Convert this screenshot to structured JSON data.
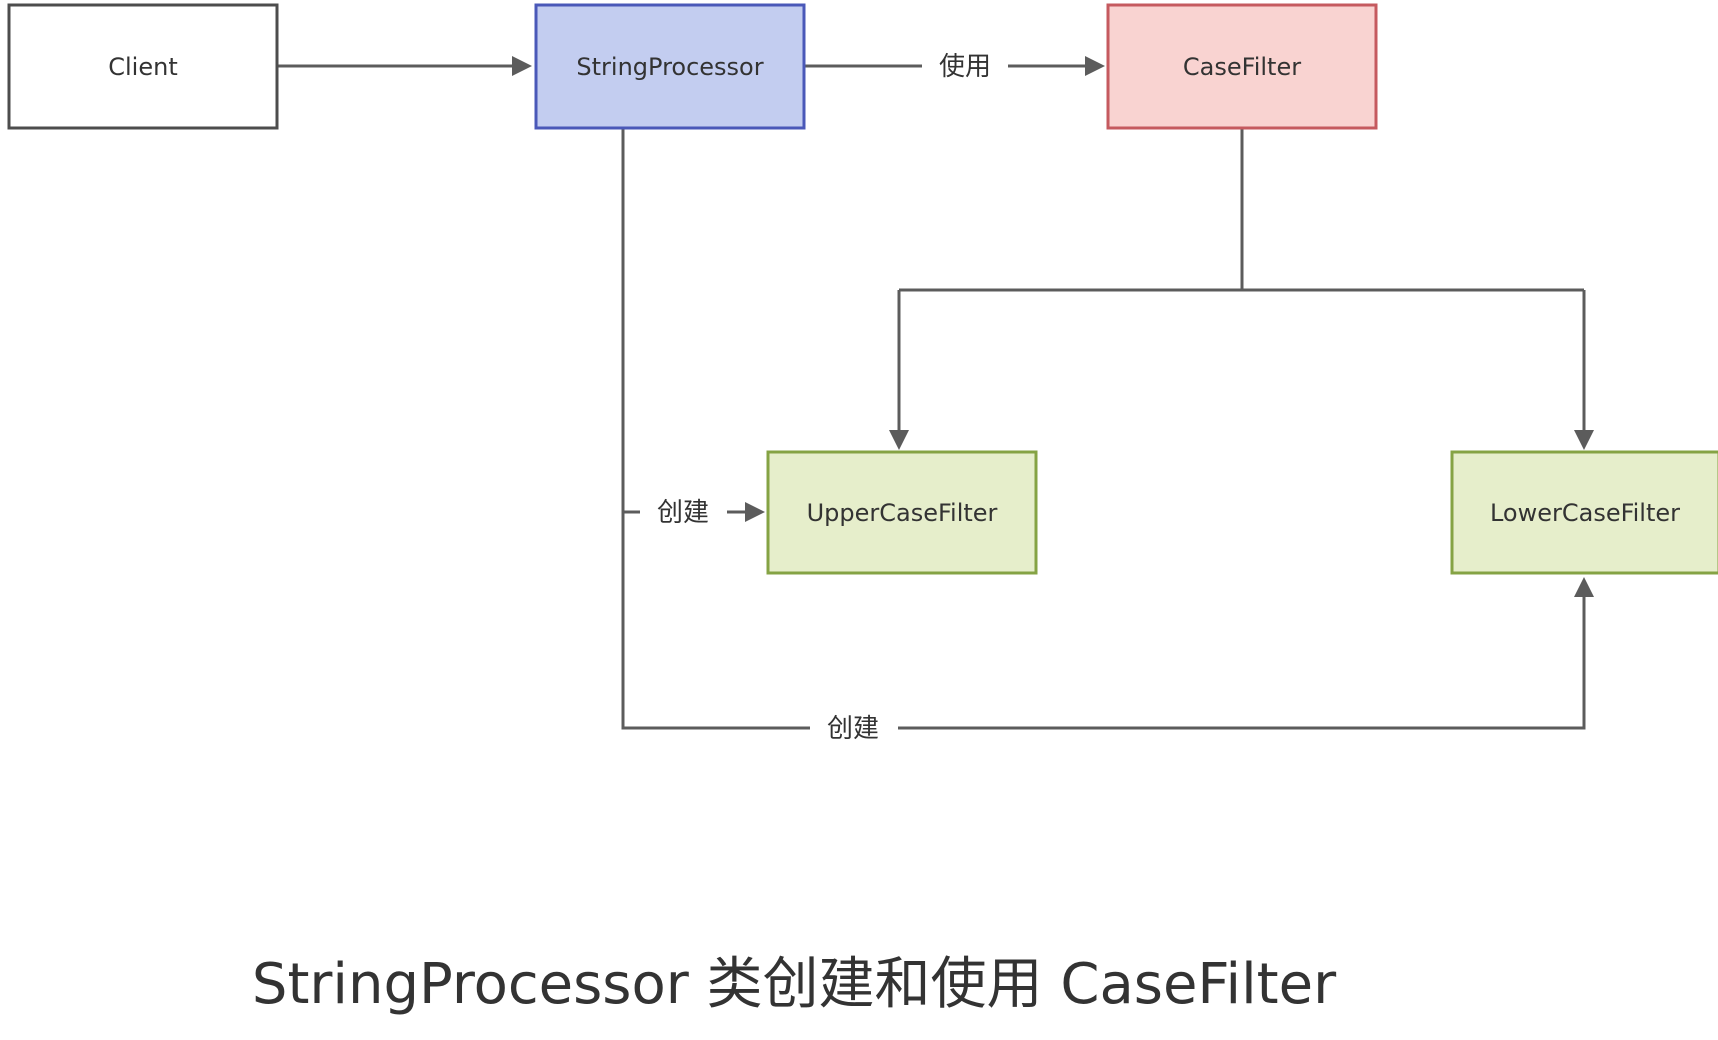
{
  "nodes": {
    "client": {
      "label": "Client",
      "fill": "#ffffff",
      "stroke": "#4d4d4d"
    },
    "string_processor": {
      "label": "StringProcessor",
      "fill": "#c3cdf0",
      "stroke": "#4a58b8"
    },
    "case_filter": {
      "label": "CaseFilter",
      "fill": "#f9d3d1",
      "stroke": "#c55a5f"
    },
    "upper_case_filter": {
      "label": "UpperCaseFilter",
      "fill": "#e6eecb",
      "stroke": "#85a344"
    },
    "lower_case_filter": {
      "label": "LowerCaseFilter",
      "fill": "#e6eecb",
      "stroke": "#85a344"
    }
  },
  "edges": {
    "client_to_processor": {
      "label": ""
    },
    "processor_uses_filter": {
      "label": "使用"
    },
    "processor_creates_upper": {
      "label": "创建"
    },
    "processor_creates_lower": {
      "label": "创建"
    },
    "filter_to_upper": {
      "label": ""
    },
    "filter_to_lower": {
      "label": ""
    }
  },
  "caption": "StringProcessor 类创建和使用 CaseFilter"
}
